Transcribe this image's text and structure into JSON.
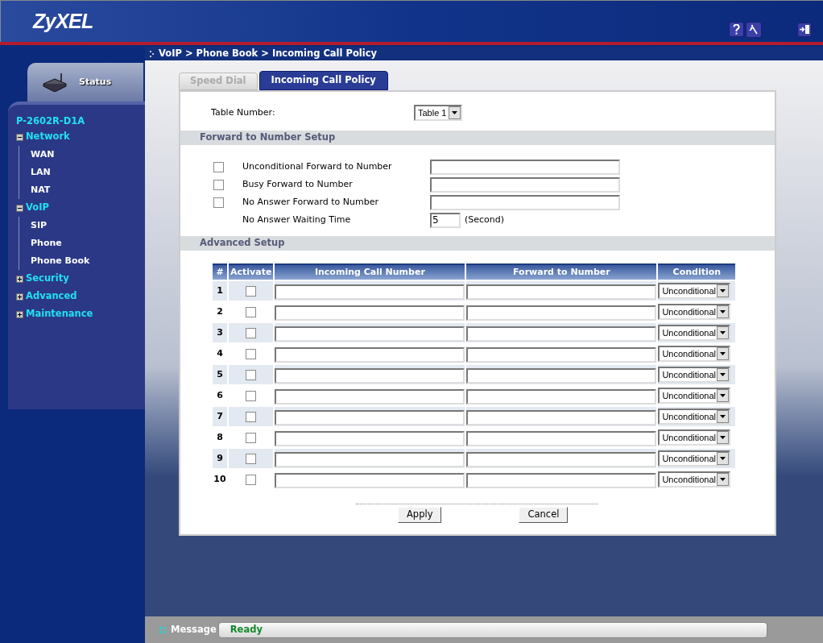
{
  "header": {
    "logo": "ZyXEL"
  },
  "sidebar": {
    "status_tab": "Status",
    "device": "P-2602R-D1A",
    "tree": [
      {
        "label": "Network",
        "expanded": true,
        "children": [
          {
            "label": "WAN"
          },
          {
            "label": "LAN"
          },
          {
            "label": "NAT"
          }
        ]
      },
      {
        "label": "VoIP",
        "expanded": true,
        "children": [
          {
            "label": "SIP"
          },
          {
            "label": "Phone"
          },
          {
            "label": "Phone Book"
          }
        ]
      },
      {
        "label": "Security",
        "expanded": false
      },
      {
        "label": "Advanced",
        "expanded": false
      },
      {
        "label": "Maintenance",
        "expanded": false
      }
    ]
  },
  "breadcrumb": "VoIP > Phone Book > Incoming Call Policy",
  "tabs": [
    {
      "label": "Speed Dial",
      "selected": false
    },
    {
      "label": "Incoming Call Policy",
      "selected": true
    }
  ],
  "table_number": {
    "label": "Table Number:",
    "value": "Table 1"
  },
  "forward_setup": {
    "title": "Forward to Number Setup",
    "rows": [
      {
        "kind": "checkbox",
        "label": "Unconditional Forward to Number",
        "checked": false
      },
      {
        "kind": "checkbox",
        "label": "Busy Forward to Number",
        "checked": false
      },
      {
        "kind": "checkbox",
        "label": "No Answer Forward to Number",
        "checked": false
      },
      {
        "kind": "time",
        "label": "No Answer Waiting Time",
        "value": "5",
        "unit": "(Second)"
      }
    ]
  },
  "advanced_setup": {
    "title": "Advanced Setup",
    "columns": [
      "#",
      "Activate",
      "Incoming Call Number",
      "Forward to Number",
      "Condition"
    ],
    "rows": [
      {
        "number": "1",
        "activate": false,
        "condition": "Unconditional"
      },
      {
        "number": "2",
        "activate": false,
        "condition": "Unconditional"
      },
      {
        "number": "3",
        "activate": false,
        "condition": "Unconditional"
      },
      {
        "number": "4",
        "activate": false,
        "condition": "Unconditional"
      },
      {
        "number": "5",
        "activate": false,
        "condition": "Unconditional"
      },
      {
        "number": "6",
        "activate": false,
        "condition": "Unconditional"
      },
      {
        "number": "7",
        "activate": false,
        "condition": "Unconditional"
      },
      {
        "number": "8",
        "activate": false,
        "condition": "Unconditional"
      },
      {
        "number": "9",
        "activate": false,
        "condition": "Unconditional"
      },
      {
        "number": "10",
        "activate": false,
        "condition": "Unconditional"
      }
    ]
  },
  "buttons": [
    "Apply",
    "Cancel"
  ],
  "status_bar": {
    "label": "Message",
    "value": "Ready"
  }
}
